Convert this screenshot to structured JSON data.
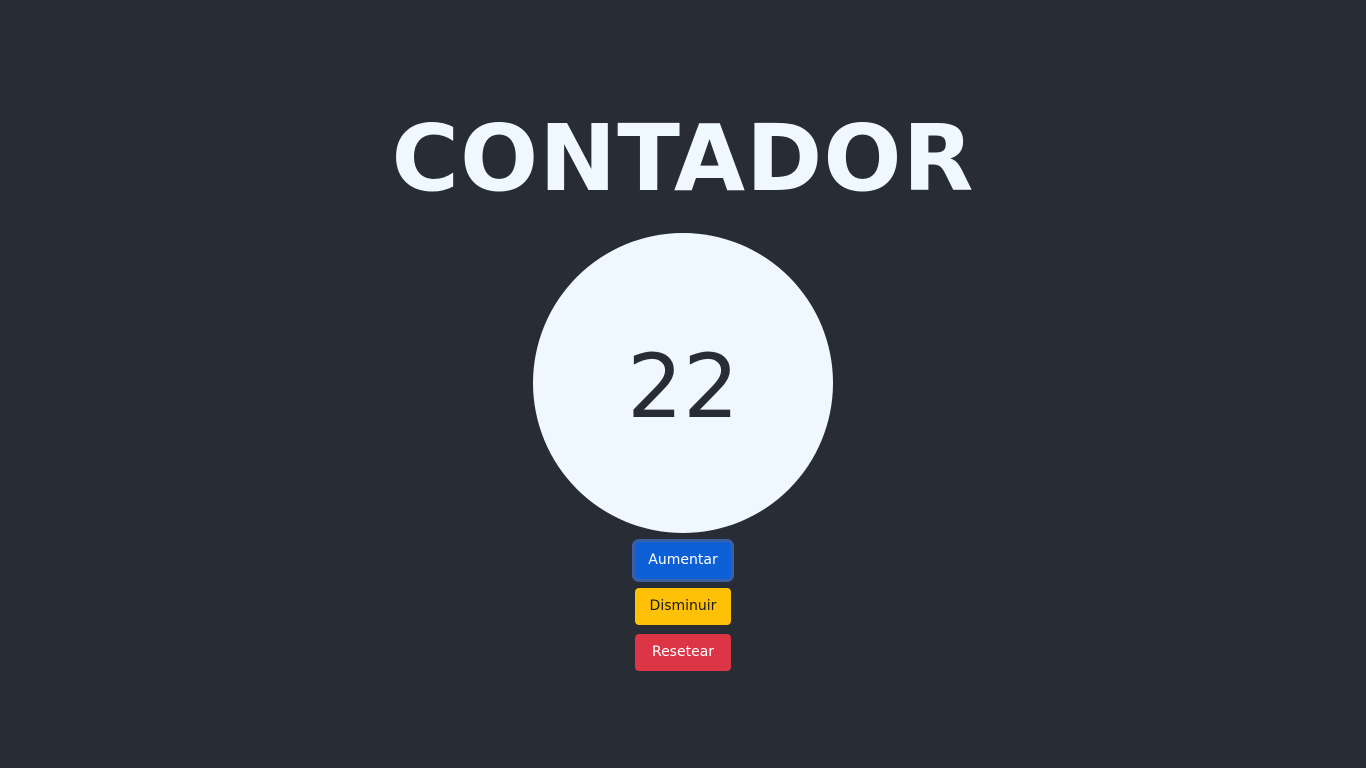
{
  "app": {
    "title": "CONTADOR"
  },
  "counter": {
    "value": "22"
  },
  "buttons": {
    "increment_label": "Aumentar",
    "decrement_label": "Disminuir",
    "reset_label": "Resetear"
  },
  "colors": {
    "background": "#282c34",
    "circle": "#f0f8ff",
    "primary": "#0d5fd6",
    "warning": "#ffc107",
    "danger": "#dc3545"
  }
}
